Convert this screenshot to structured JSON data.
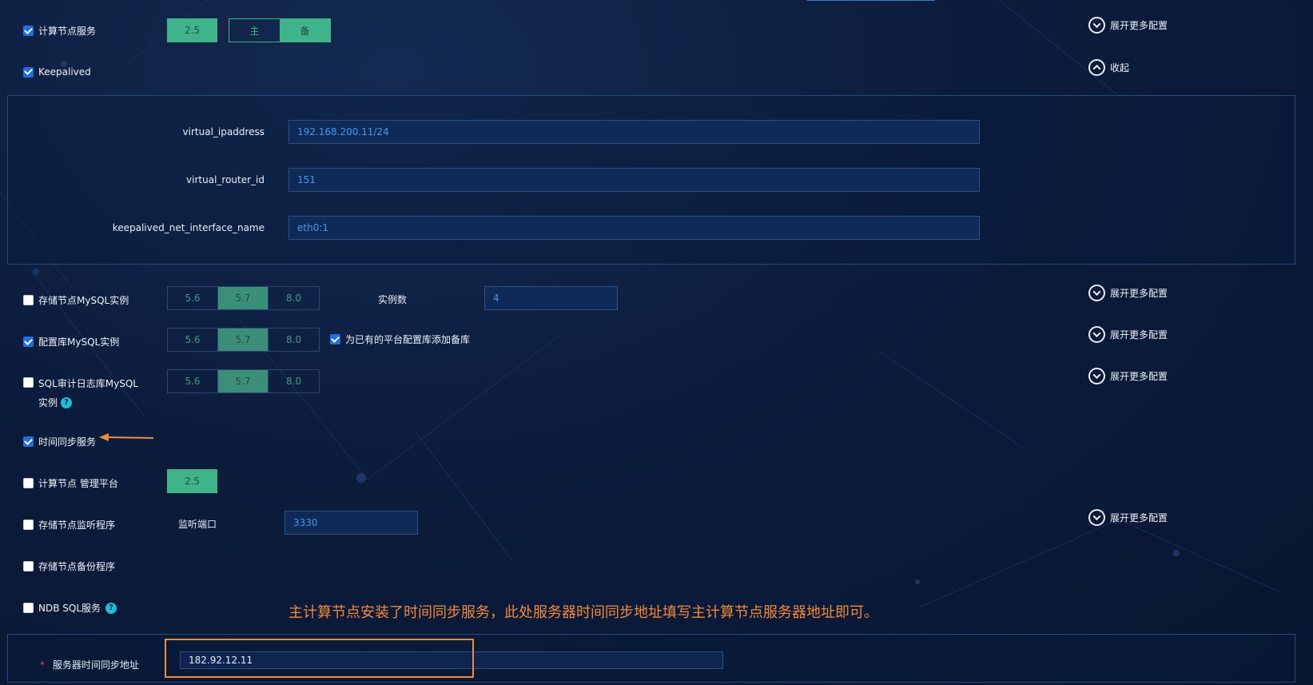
{
  "rows": {
    "compute_service": {
      "label": "计算节点服务",
      "checked": true,
      "version": "2.5",
      "role_main": "主",
      "role_backup": "备",
      "expand": "展开更多配置"
    },
    "keepalived": {
      "label": "Keepalived",
      "checked": true,
      "collapse": "收起"
    },
    "storage_mysql": {
      "label": "存储节点MySQL实例",
      "checked": false,
      "versions": [
        "5.6",
        "5.7",
        "8.0"
      ],
      "instances_label": "实例数",
      "instances_value": "4",
      "expand": "展开更多配置"
    },
    "config_mysql": {
      "label": "配置库MySQL实例",
      "checked": true,
      "versions": [
        "5.6",
        "5.7",
        "8.0"
      ],
      "extra_checkbox": "为已有的平台配置库添加备库",
      "extra_checked": true,
      "expand": "展开更多配置"
    },
    "sql_audit": {
      "label_line1": "SQL审计日志库MySQL",
      "label_line2": "实例",
      "checked": false,
      "versions": [
        "5.6",
        "5.7",
        "8.0"
      ],
      "expand": "展开更多配置"
    },
    "time_sync": {
      "label": "时间同步服务",
      "checked": true
    },
    "compute_mgmt": {
      "label": "计算节点 管理平台",
      "checked": false,
      "version": "2.5"
    },
    "storage_monitor": {
      "label": "存储节点监听程序",
      "checked": false,
      "port_label": "监听端口",
      "port_value": "3330",
      "expand": "展开更多配置"
    },
    "storage_backup": {
      "label": "存储节点备份程序",
      "checked": false
    },
    "ndb_sql": {
      "label": "NDB SQL服务",
      "checked": false
    }
  },
  "keepalived_panel": {
    "fields": [
      {
        "label": "virtual_ipaddress",
        "value": "192.168.200.11/24"
      },
      {
        "label": "virtual_router_id",
        "value": "151"
      },
      {
        "label": "keepalived_net_interface_name",
        "value": "eth0:1"
      }
    ]
  },
  "annotation": "主计算节点安装了时间同步服务，此处服务器时间同步地址填写主计算节点服务器地址即可。",
  "time_server": {
    "required_mark": "*",
    "label": "服务器时间同步地址",
    "value": "182.92.12.11"
  },
  "colors": {
    "accent_green": "#3fb48a",
    "annotation_orange": "#f28a3a",
    "checkbox_blue": "#1f6fe0"
  }
}
